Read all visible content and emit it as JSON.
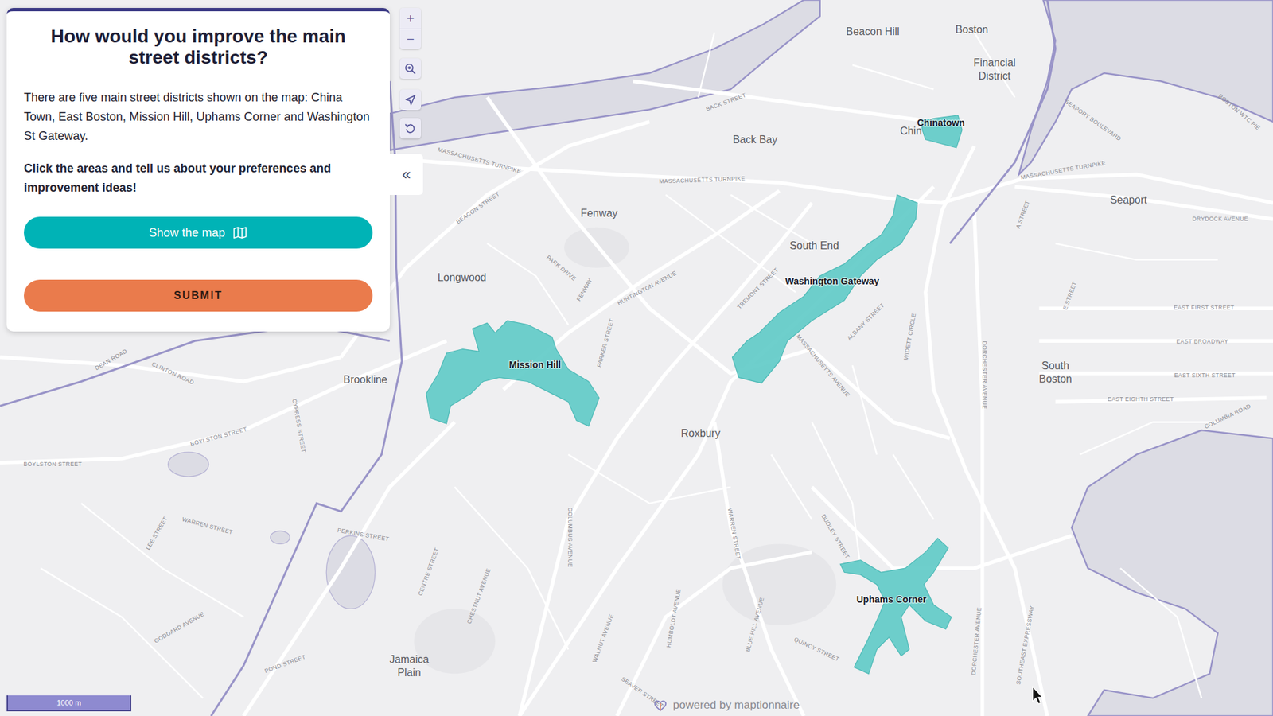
{
  "panel": {
    "title": "How would you improve the main street districts?",
    "description": "There are five main street districts shown on the map: China Town, East Boston, Mission Hill, Uphams Corner and Washington St Gateway.",
    "instruction": "Click the areas and tell us about your preferences and improvement ideas!",
    "buttons": [
      {
        "label": "Show the map",
        "kind": "map"
      },
      {
        "label": "SUBMIT",
        "kind": "submit"
      }
    ]
  },
  "zoom_buttons": [
    "+",
    "−"
  ],
  "collapse": "«",
  "districts": [
    {
      "name": "Chinatown"
    },
    {
      "name": "Washington Gateway"
    },
    {
      "name": "Mission Hill"
    },
    {
      "name": "Uphams Corner"
    }
  ],
  "places": [
    "Beacon Hill",
    "Boston",
    "Financial District",
    "Back Bay",
    "Chin",
    "Fenway",
    "South End",
    "Longwood",
    "Brookline",
    "Roxbury",
    "Seaport",
    "South Boston",
    "Jamaica Plain"
  ],
  "streets": [
    "BACK STREET",
    "MASSACHUSETTS TURNPIKE",
    "MASSACHUSETTS TURNPIKE",
    "MASSACHUSETTS TURNPIKE",
    "BEACON STREET",
    "PARK DRIVE",
    "FENWAY",
    "HUNTINGTON AVENUE",
    "PARKER STREET",
    "TREMONT STREET",
    "ALBANY STREET",
    "MASSACHUSETTS AVENUE",
    "WIDETT CIRCLE",
    "DORCHESTER AVENUE",
    "EAST FIRST STREET",
    "EAST BROADWAY",
    "EAST SIXTH STREET",
    "EAST EIGHTH STREET",
    "COLUMBIA ROAD",
    "DRYDOCK AVENUE",
    "A STREET",
    "E STREET",
    "SEAPORT BOULEVARD",
    "BOSTON WTC PIE",
    "CLINTON ROAD",
    "DEAN ROAD",
    "BOYLSTON STREET",
    "BOYLSTON STREET",
    "CYPRESS STREET",
    "WARREN STREET",
    "LEE STREET",
    "PERKINS STREET",
    "CENTRE STREET",
    "CHESTNUT AVENUE",
    "COLUMBUS AVENUE",
    "WALNUT AVENUE",
    "HUMBOLDT AVENUE",
    "WARREN STREET",
    "BLUE HILL AVENUE",
    "DUDLEY STREET",
    "QUINCY STREET",
    "DORCHESTER AVENUE",
    "SOUTHEAST EXPRESSWAY",
    "GODDARD AVENUE",
    "POND STREET",
    "SEAVER STREET"
  ],
  "scale": "1000 m",
  "attribution": "powered by maptionnaire"
}
